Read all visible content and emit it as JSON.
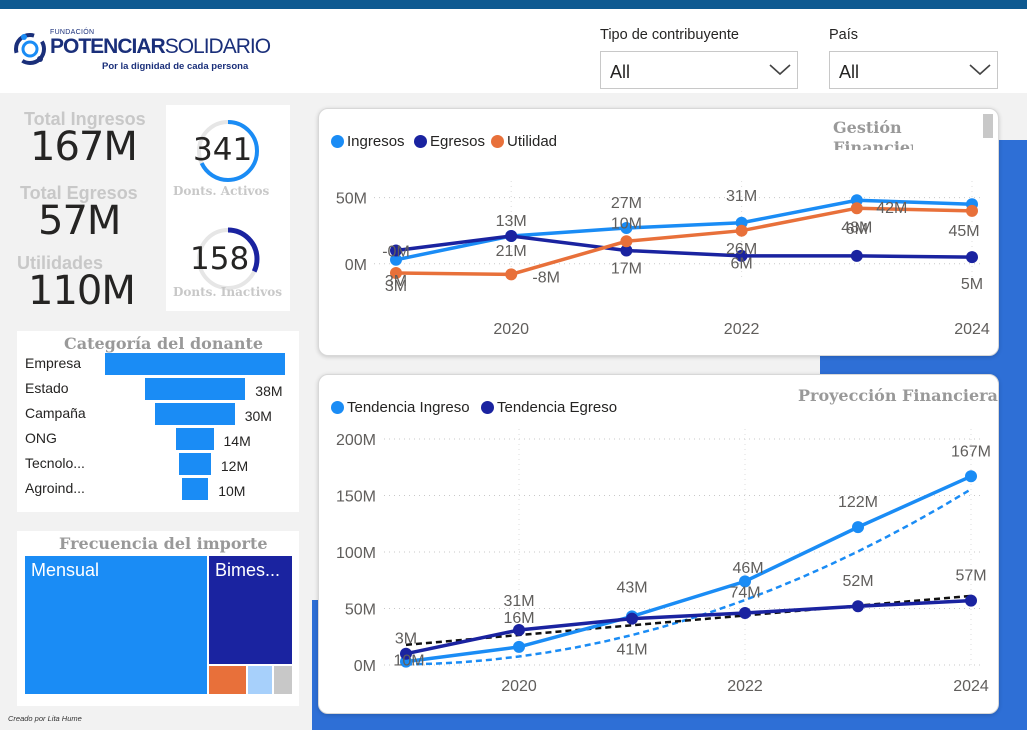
{
  "header": {
    "logo": {
      "small": "FUNDACIÓN",
      "name_part1": "POTENCIAR",
      "name_part2": "SOLIDARIO",
      "tagline": "Por la dignidad de cada persona"
    },
    "slicers": [
      {
        "label": "Tipo de contribuyente",
        "value": "All"
      },
      {
        "label": "País",
        "value": "All"
      }
    ]
  },
  "kpis": {
    "ingresos": {
      "label": "Total Ingresos",
      "value": "167M"
    },
    "egresos": {
      "label": "Total Egresos",
      "value": "57M"
    },
    "utilidades": {
      "label": "Utilidades",
      "value": "110M"
    }
  },
  "donors": {
    "activos": {
      "value": "341",
      "label": "Donts. Activos",
      "fraction": 0.68
    },
    "inactivos": {
      "value": "158",
      "label": "Donts.  Inactivos",
      "fraction": 0.32
    }
  },
  "categoria": {
    "title": "Categoría del donante",
    "rows": [
      {
        "label": "Empresa",
        "value": "",
        "amount": 68
      },
      {
        "label": "Estado",
        "value": "38M",
        "amount": 38
      },
      {
        "label": "Campaña",
        "value": "30M",
        "amount": 30
      },
      {
        "label": "ONG",
        "value": "14M",
        "amount": 14
      },
      {
        "label": "Tecnolo...",
        "value": "12M",
        "amount": 12
      },
      {
        "label": "Agroind...",
        "value": "10M",
        "amount": 10
      }
    ]
  },
  "frecuencia": {
    "title": "Frecuencia del importe",
    "cells": [
      {
        "label": "Mensual",
        "color": "#1a8cf5"
      },
      {
        "label": "Bimes...",
        "color": "#1a23a0"
      },
      {
        "label": "",
        "color": "#e8703a"
      },
      {
        "label": "",
        "color": "#a7d0fb"
      },
      {
        "label": "",
        "color": "#c8c8c8"
      }
    ]
  },
  "colors": {
    "ingresos": "#1a8cf5",
    "egresos": "#1a23a0",
    "utilidad": "#e8703a"
  },
  "chart_data": [
    {
      "type": "line",
      "title": "Gestión Financiera",
      "x": [
        2019,
        2020,
        2021,
        2022,
        2023,
        2024
      ],
      "x_ticks": [
        "2020",
        "2022",
        "2024"
      ],
      "y_ticks": [
        "0M",
        "50M"
      ],
      "ylim": [
        -10,
        55
      ],
      "series": [
        {
          "name": "Ingresos",
          "values": [
            3,
            21,
            27,
            31,
            48,
            45
          ],
          "labels": [
            "3M",
            "21M",
            "27M",
            "31M",
            "48M",
            "45M"
          ]
        },
        {
          "name": "Egresos",
          "values": [
            10,
            21,
            10,
            6,
            6,
            5
          ],
          "labels": [
            "-0M",
            "13M",
            "10M",
            "26M",
            "6M",
            "5M"
          ]
        },
        {
          "name": "Utilidad",
          "values": [
            -7,
            -8,
            17,
            25,
            42,
            40
          ],
          "labels": [
            "3M",
            "-8M",
            "17M",
            "6M",
            "42M",
            ""
          ]
        }
      ]
    },
    {
      "type": "line",
      "title": "Proyección Financiera",
      "x": [
        2019,
        2020,
        2021,
        2022,
        2023,
        2024
      ],
      "x_ticks": [
        "2020",
        "2022",
        "2024"
      ],
      "y_ticks": [
        "0M",
        "50M",
        "100M",
        "150M",
        "200M"
      ],
      "ylim": [
        0,
        200
      ],
      "series": [
        {
          "name": "Tendencia Ingreso",
          "values": [
            3,
            16,
            43,
            74,
            122,
            167
          ],
          "labels": [
            "3M",
            "16M",
            "43M",
            "74M",
            "122M",
            "167M"
          ]
        },
        {
          "name": "Tendencia Egreso",
          "values": [
            10,
            31,
            41,
            46,
            52,
            57
          ],
          "labels": [
            "10M",
            "31M",
            "41M",
            "46M",
            "52M",
            "57M"
          ]
        }
      ]
    }
  ],
  "footer": {
    "credit": "Creado por Lita Hume"
  }
}
